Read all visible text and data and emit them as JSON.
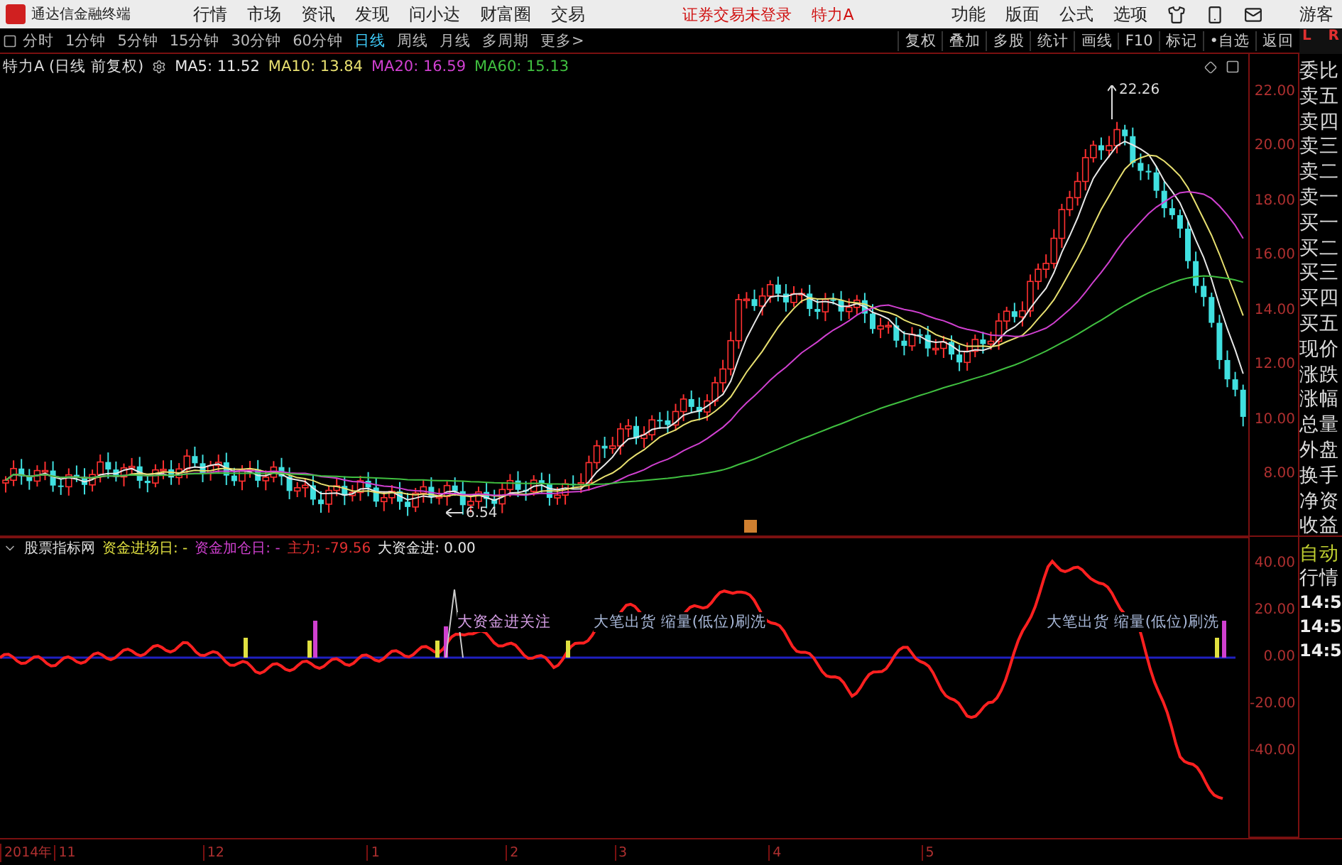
{
  "menu_bar": {
    "app_title": "通达信金融终端",
    "items": [
      "行情",
      "市场",
      "资讯",
      "发现",
      "问小达",
      "财富圈",
      "交易"
    ],
    "login_status": "证券交易未登录",
    "stock_name": "特力A",
    "tools": [
      "功能",
      "版面",
      "公式",
      "选项"
    ],
    "user": "游客"
  },
  "toolbar": {
    "periods": [
      {
        "label": "分时",
        "selected": false
      },
      {
        "label": "1分钟",
        "selected": false
      },
      {
        "label": "5分钟",
        "selected": false
      },
      {
        "label": "15分钟",
        "selected": false
      },
      {
        "label": "30分钟",
        "selected": false
      },
      {
        "label": "60分钟",
        "selected": false
      },
      {
        "label": "日线",
        "selected": true
      },
      {
        "label": "周线",
        "selected": false
      },
      {
        "label": "月线",
        "selected": false
      },
      {
        "label": "多周期",
        "selected": false
      }
    ],
    "more": "更多>",
    "buttons": [
      "复权",
      "叠加",
      "多股",
      "统计",
      "画线",
      "F10",
      "标记",
      "•自选",
      "返回"
    ]
  },
  "price_chart": {
    "title": "特力A (日线 前复权)",
    "ma": [
      {
        "label": "MA5: 11.52",
        "color": "#e8e8e8"
      },
      {
        "label": "MA10: 13.84",
        "color": "#e8e070"
      },
      {
        "label": "MA20: 16.59",
        "color": "#d040d0"
      },
      {
        "label": "MA60: 15.13",
        "color": "#40c040"
      }
    ],
    "high_label": "22.26",
    "low_label": "6.54",
    "axis": [
      "22.00",
      "20.00",
      "18.00",
      "16.00",
      "14.00",
      "12.00",
      "10.00",
      "8.00"
    ]
  },
  "indicator": {
    "name": "股票指标网",
    "readouts": [
      {
        "label": "资金进场日: -",
        "color": "#e0e040"
      },
      {
        "label": "资金加仓日: -",
        "color": "#d040d0"
      },
      {
        "label": "主力: -79.56",
        "color": "#e03030"
      },
      {
        "label": "大资金进: 0.00",
        "color": "#e8e8e8"
      }
    ],
    "annotations": [
      "大资金进关注",
      "大笔出货 缩量(低位)刷洗",
      "大笔出货 缩量(低位)刷洗"
    ],
    "axis": [
      "40.00",
      "20.00",
      "0.00",
      "-20.00",
      "-40.00"
    ]
  },
  "time_axis": [
    "2014年",
    "11",
    "12",
    "1",
    "2",
    "3",
    "4",
    "5"
  ],
  "side_panel": {
    "corner": [
      "L",
      "R"
    ],
    "quote_fields": [
      "委比",
      "卖五",
      "卖四",
      "卖三",
      "卖二",
      "卖一",
      "买一",
      "买二",
      "买三",
      "买四",
      "买五",
      "现价",
      "涨跌",
      "涨幅",
      "总量",
      "外盘",
      "换手",
      "净资",
      "收益"
    ],
    "auto": "自动",
    "market": "行情",
    "times": [
      "14:5",
      "14:5",
      "14:5"
    ]
  }
}
